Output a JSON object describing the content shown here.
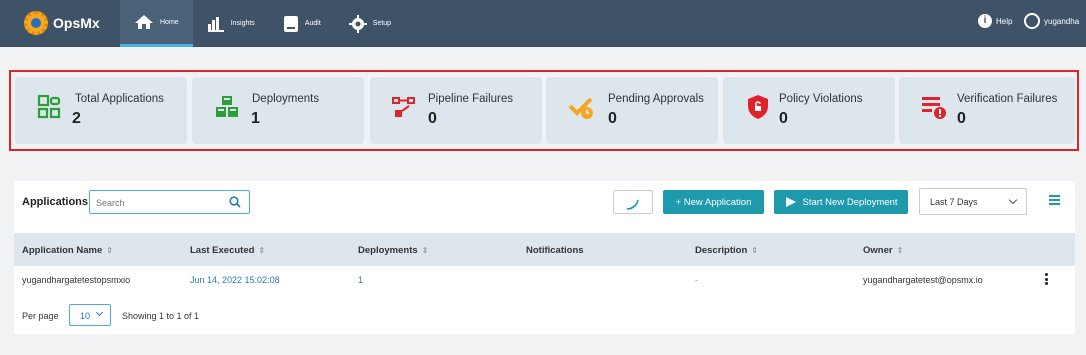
{
  "brand": {
    "name": "OpsMx"
  },
  "nav": [
    {
      "label": "Home",
      "icon": "home-icon"
    },
    {
      "label": "Insights",
      "icon": "insights-icon"
    },
    {
      "label": "Audit",
      "icon": "audit-icon"
    },
    {
      "label": "Setup",
      "icon": "gear-icon"
    }
  ],
  "header": {
    "help_label": "Help",
    "user_name": "yugandha"
  },
  "cards": [
    {
      "label": "Total Applications",
      "value": "2",
      "icon": "applications-grid-icon",
      "color": "#2e9e3a"
    },
    {
      "label": "Deployments",
      "value": "1",
      "icon": "cubes-icon",
      "color": "#2e9e3a"
    },
    {
      "label": "Pipeline Failures",
      "value": "0",
      "icon": "pipeline-failure-icon",
      "color": "#e0232b"
    },
    {
      "label": "Pending Approvals",
      "value": "0",
      "icon": "pending-approval-icon",
      "color": "#f5a623"
    },
    {
      "label": "Policy Violations",
      "value": "0",
      "icon": "shield-lock-icon",
      "color": "#e0232b"
    },
    {
      "label": "Verification Failures",
      "value": "0",
      "icon": "verification-failure-icon",
      "color": "#e0232b"
    }
  ],
  "toolbar": {
    "title": "Applications",
    "search_placeholder": "Search",
    "new_application_label": "+ New Application",
    "start_deployment_label": "Start New Deployment",
    "range_label": "Last 7 Days"
  },
  "table": {
    "columns": [
      "Application Name",
      "Last Executed",
      "Deployments",
      "Notifications",
      "Description",
      "Owner"
    ],
    "rows": [
      {
        "name": "yugandhargatetestopsmxio",
        "last_executed": "Jun 14, 2022 15:02:08",
        "deployments": "1",
        "notifications": "",
        "description": "-",
        "owner": "yugandhargatetest@opsmx.io"
      }
    ]
  },
  "pagination": {
    "per_page_label": "Per page",
    "per_page_value": "10",
    "showing": "Showing 1 to 1 of 1"
  },
  "colors": {
    "topbar": "#3f5368",
    "accent": "#1e9aac",
    "highlight": "#e0232b"
  }
}
